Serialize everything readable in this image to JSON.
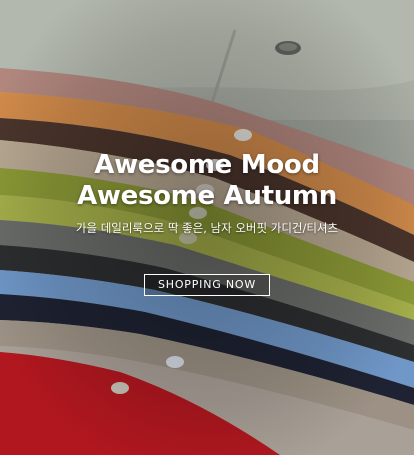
{
  "banner": {
    "title_line1": "Awesome Mood",
    "title_line2": "Awesome Autumn",
    "subtitle": "가을 데일리룩으로 딱 좋은, 남자 오버핏 가디건/티셔츠",
    "cta_label": "SHOPPING NOW",
    "image_subject": "stack-of-folded-cardigans-and-tshirts"
  }
}
